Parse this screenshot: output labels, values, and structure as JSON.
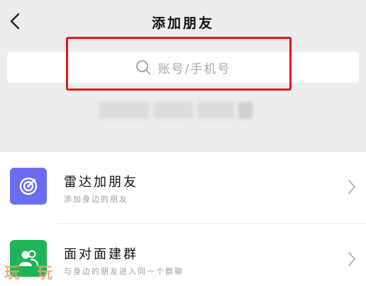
{
  "header": {
    "title": "添加朋友"
  },
  "search": {
    "placeholder": "账号/手机号"
  },
  "list": {
    "items": [
      {
        "title": "雷达加朋友",
        "subtitle": "添加身边的朋友",
        "icon": "radar-icon",
        "icon_color": "#6b6df0"
      },
      {
        "title": "面对面建群",
        "subtitle": "与身边的朋友进入同一个群聊",
        "icon": "group-person-icon",
        "icon_color": "#1fb35a"
      }
    ]
  },
  "watermark": "玩玩",
  "colors": {
    "highlight": "#e4171d",
    "background": "#ededed"
  }
}
